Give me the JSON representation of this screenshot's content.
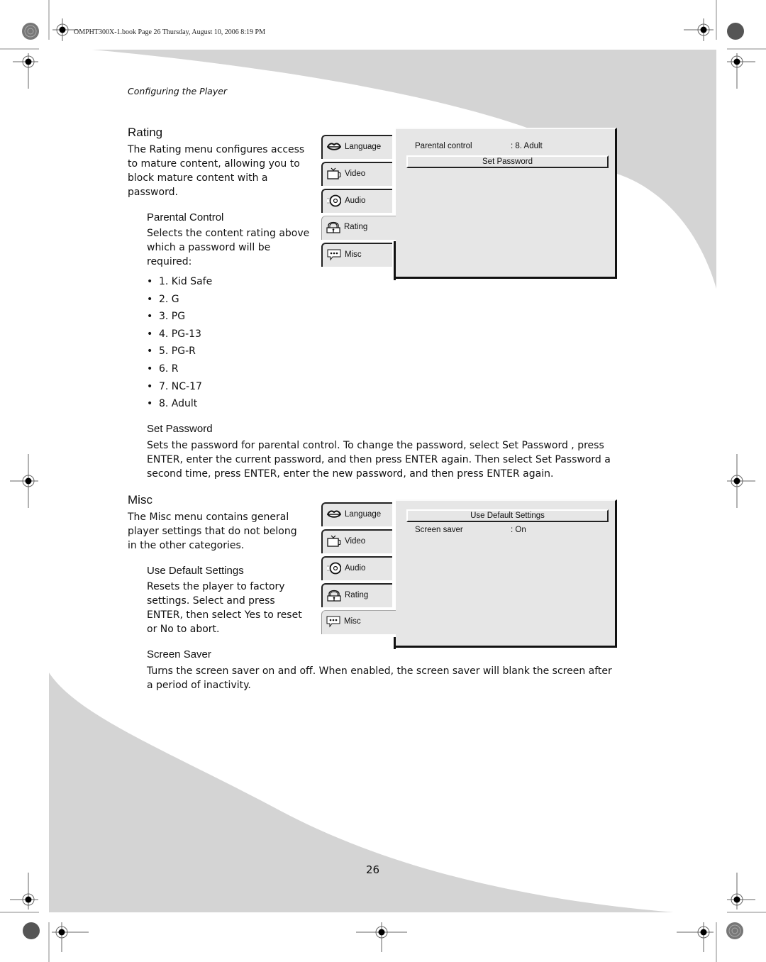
{
  "slug": "OMPHT300X-1.book  Page 26  Thursday, August 10, 2006  8:19 PM",
  "running_head": "Configuring the Player",
  "colors": {
    "band": "#d4d4d4",
    "osd_bg": "#e6e6e6",
    "text": "#111111"
  },
  "rating": {
    "title": "Rating",
    "intro": "The Rating menu configures access to mature content, allowing you to block mature content with a password.",
    "parental": {
      "title": "Parental Control",
      "text": "Selects the content rating above which a password will be required:",
      "options": [
        "1. Kid Safe",
        "2. G",
        "3. PG",
        "4. PG-13",
        "5. PG-R",
        "6. R",
        "7. NC-17",
        "8. Adult"
      ]
    },
    "set_password": {
      "title": "Set Password",
      "text": "Sets the password for parental control. To change the password, select Set Password , press ENTER, enter the current password, and then press ENTER again. Then select Set Password a second time, press ENTER, enter the new password, and then press ENTER again."
    },
    "menu": {
      "tabs": [
        {
          "label": "Language",
          "icon": "lips-icon"
        },
        {
          "label": "Video",
          "icon": "tv-icon"
        },
        {
          "label": "Audio",
          "icon": "disc-icon"
        },
        {
          "label": "Rating",
          "icon": "lock-icon"
        },
        {
          "label": "Misc",
          "icon": "speech-bubble-icon"
        }
      ],
      "active_tab": "Rating",
      "parental_label": "Parental control",
      "parental_value": ": 8. Adult",
      "set_password_button": "Set Password"
    }
  },
  "misc": {
    "title": "Misc",
    "intro": "The Misc menu contains general player settings that do not belong in the other categories.",
    "defaults": {
      "title": "Use Default Settings",
      "text": "Resets the player to factory settings. Select and press ENTER, then select Yes to reset or No to abort."
    },
    "screensaver": {
      "title": "Screen Saver",
      "text": "Turns the screen saver on and off. When enabled, the screen saver will blank the screen after a period of inactivity."
    },
    "menu": {
      "tabs": [
        {
          "label": "Language",
          "icon": "lips-icon"
        },
        {
          "label": "Video",
          "icon": "tv-icon"
        },
        {
          "label": "Audio",
          "icon": "disc-icon"
        },
        {
          "label": "Rating",
          "icon": "lock-icon"
        },
        {
          "label": "Misc",
          "icon": "speech-bubble-icon"
        }
      ],
      "active_tab": "Misc",
      "default_button": "Use Default Settings",
      "screensaver_label": "Screen saver",
      "screensaver_value": ": On"
    }
  },
  "page_number": "26"
}
